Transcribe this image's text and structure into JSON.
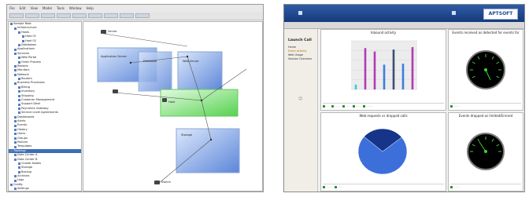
{
  "left": {
    "menu": [
      "File",
      "Edit",
      "View",
      "Model",
      "Tools",
      "Window",
      "Help"
    ],
    "tree_rows": [
      {
        "text": "Sample Root",
        "indent": 0
      },
      {
        "text": "Infrastructure",
        "indent": 1
      },
      {
        "text": "Hosts",
        "indent": 2
      },
      {
        "text": "Host 01",
        "indent": 3
      },
      {
        "text": "Host 02",
        "indent": 3
      },
      {
        "text": "Databases",
        "indent": 2
      },
      {
        "text": "Applications",
        "indent": 1
      },
      {
        "text": "Services",
        "indent": 1
      },
      {
        "text": "Web Portal",
        "indent": 2
      },
      {
        "text": "Order Process",
        "indent": 2
      },
      {
        "text": "Reports",
        "indent": 1
      },
      {
        "text": "Monitors",
        "indent": 1
      },
      {
        "text": "Network",
        "indent": 1
      },
      {
        "text": "Routers",
        "indent": 2
      },
      {
        "text": "Business Processes",
        "indent": 1
      },
      {
        "text": "Billing",
        "indent": 2
      },
      {
        "text": "Inventory",
        "indent": 2
      },
      {
        "text": "Shipping",
        "indent": 2
      },
      {
        "text": "Customer Management",
        "indent": 2
      },
      {
        "text": "Support Desk",
        "indent": 2
      },
      {
        "text": "Payments Gateway",
        "indent": 2
      },
      {
        "text": "Service Level Agreements",
        "indent": 2
      },
      {
        "text": "Dashboards",
        "indent": 1
      },
      {
        "text": "Alerts",
        "indent": 1
      },
      {
        "text": "Events",
        "indent": 1
      },
      {
        "text": "History",
        "indent": 1
      },
      {
        "text": "Users",
        "indent": 1
      },
      {
        "text": "Groups",
        "indent": 1
      },
      {
        "text": "Policies",
        "indent": 1
      },
      {
        "text": "Templates",
        "indent": 1
      },
      {
        "text": "Topology",
        "indent": 0,
        "selected": true
      },
      {
        "text": "Data Center A",
        "indent": 1
      },
      {
        "text": "Data Center B",
        "indent": 1
      },
      {
        "text": "Cluster Nodes",
        "indent": 2
      },
      {
        "text": "Storage",
        "indent": 2
      },
      {
        "text": "Backup",
        "indent": 2
      },
      {
        "text": "Archives",
        "indent": 1
      },
      {
        "text": "Logs",
        "indent": 1
      },
      {
        "text": "Config",
        "indent": 0
      },
      {
        "text": "Settings",
        "indent": 1
      }
    ],
    "node_labels": {
      "n1": "Server",
      "n2": "Application Server",
      "n3": "Database",
      "n4": "Web Server",
      "n5": "Host",
      "n6": "Storage",
      "n7": "Switch"
    }
  },
  "right": {
    "logo": "APTSOFT",
    "sidebar_title": "Launch Call",
    "sidebar_items": [
      "Home",
      "Event Activity",
      "Web Usage",
      "Session Overview"
    ],
    "cards": {
      "activity_title": "Inbound activity",
      "gauge1_title": "Events received as detected for events for",
      "pie_title": "Web requests vs dropped calls",
      "gauge2_title": "Events dropped as limited/Errored"
    },
    "colors": {
      "header": "#1d4b96",
      "bar1": "#3fc9d9",
      "bar2": "#b23ab5",
      "bar3": "#3b7fe0",
      "bar4": "#3d4c78"
    }
  },
  "chart_data": [
    {
      "type": "bar",
      "title": "Inbound activity",
      "categories": [
        "",
        "",
        "",
        "",
        "",
        "",
        ""
      ],
      "values": [
        1,
        8.5,
        7.8,
        5.1,
        8.2,
        5.3,
        8.7
      ],
      "ylim": [
        0,
        10
      ]
    },
    {
      "type": "pie",
      "title": "Web requests vs dropped calls",
      "values": [
        72,
        28
      ]
    }
  ]
}
